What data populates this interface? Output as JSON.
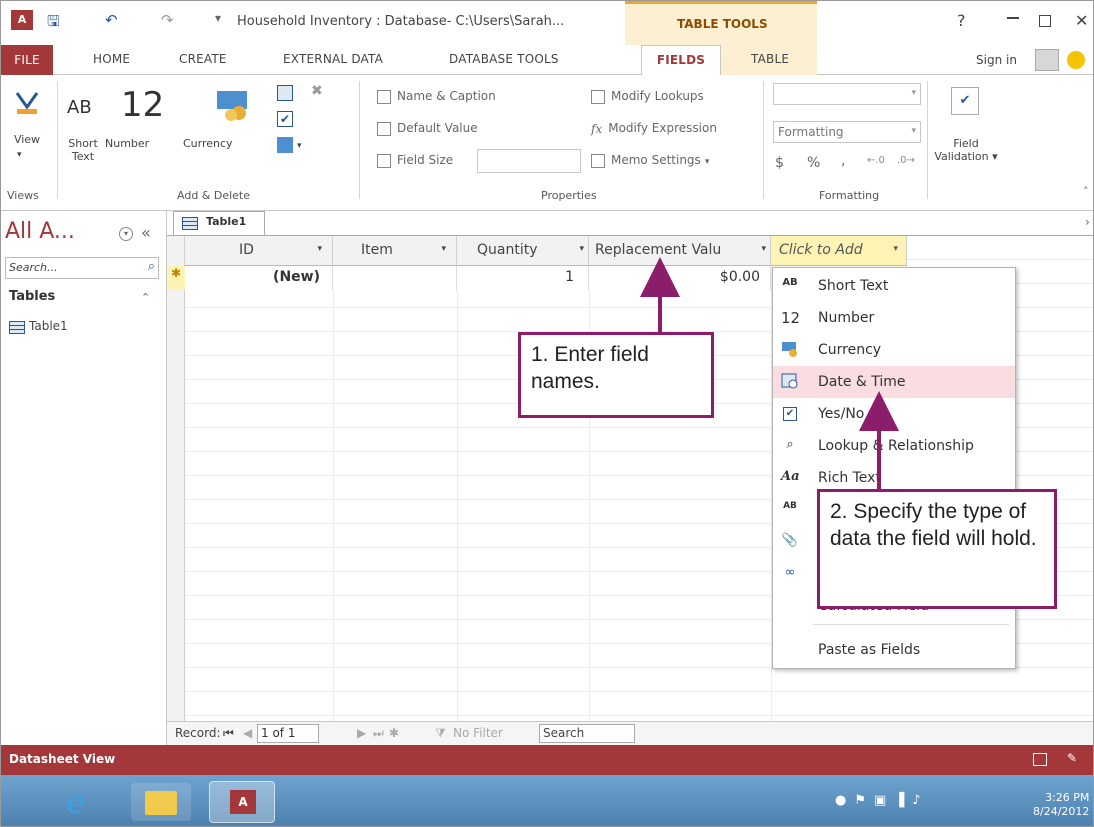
{
  "window": {
    "title": "Household Inventory : Database- C:\\Users\\Sarah...",
    "contextual_group": "TABLE TOOLS",
    "help": "?",
    "sign_in": "Sign in"
  },
  "ribbon_tabs": [
    "FILE",
    "HOME",
    "CREATE",
    "EXTERNAL DATA",
    "DATABASE TOOLS",
    "FIELDS",
    "TABLE"
  ],
  "ribbon": {
    "views": {
      "group": "Views",
      "view": "View"
    },
    "add_delete": {
      "group": "Add & Delete",
      "short_text_icon": "AB",
      "short_text_label1": "Short",
      "short_text_label2": "Text",
      "number_icon": "12",
      "number_label": "Number",
      "currency_label": "Currency"
    },
    "properties": {
      "group": "Properties",
      "name_caption": "Name & Caption",
      "default_value": "Default Value",
      "field_size": "Field Size",
      "modify_lookups": "Modify Lookups",
      "modify_expression": "Modify Expression",
      "memo_settings": "Memo Settings"
    },
    "formatting": {
      "group": "Formatting",
      "formatting_combo": "Formatting",
      "currency_sym": "$",
      "percent_sym": "%",
      "comma_sym": ","
    },
    "field_validation": {
      "label1": "Field",
      "label2": "Validation"
    }
  },
  "nav_pane": {
    "title": "All A...",
    "search_placeholder": "Search...",
    "section": "Tables",
    "items": [
      "Table1"
    ]
  },
  "document_tab": "Table1",
  "grid": {
    "columns": [
      "ID",
      "Item",
      "Quantity",
      "Replacement Valu",
      "Click to Add"
    ],
    "new_row": {
      "id": "(New)",
      "item": "",
      "quantity": "1",
      "replacement_value": "$0.00"
    }
  },
  "add_field_menu": {
    "items": [
      {
        "icon": "AB",
        "label": "Short Text"
      },
      {
        "icon": "12",
        "label": "Number"
      },
      {
        "icon": "",
        "label": "Currency"
      },
      {
        "icon": "",
        "label": "Date & Time"
      },
      {
        "icon": "",
        "label": "Yes/No"
      },
      {
        "icon": "",
        "label": "Lookup & Relationship"
      },
      {
        "icon": "Aa",
        "label": "Rich Text"
      },
      {
        "icon": "AB",
        "label": ""
      },
      {
        "icon": "",
        "label": ""
      },
      {
        "icon": "",
        "label": ""
      },
      {
        "icon": "",
        "label": "Calculated Field"
      },
      {
        "icon": "",
        "label": "Paste as Fields"
      }
    ]
  },
  "callouts": {
    "step1": "1. Enter field names.",
    "step2": "2. Specify the type of data the field will hold."
  },
  "record_nav": {
    "label": "Record:",
    "position": "1 of 1",
    "filter": "No Filter",
    "search": "Search"
  },
  "status": {
    "text": "Datasheet View"
  },
  "taskbar": {
    "time": "3:26 PM",
    "date": "8/24/2012"
  },
  "colors": {
    "access_red": "#a4373a",
    "callout_border": "#8c1d6b",
    "contextual": "#fdf0d2"
  }
}
